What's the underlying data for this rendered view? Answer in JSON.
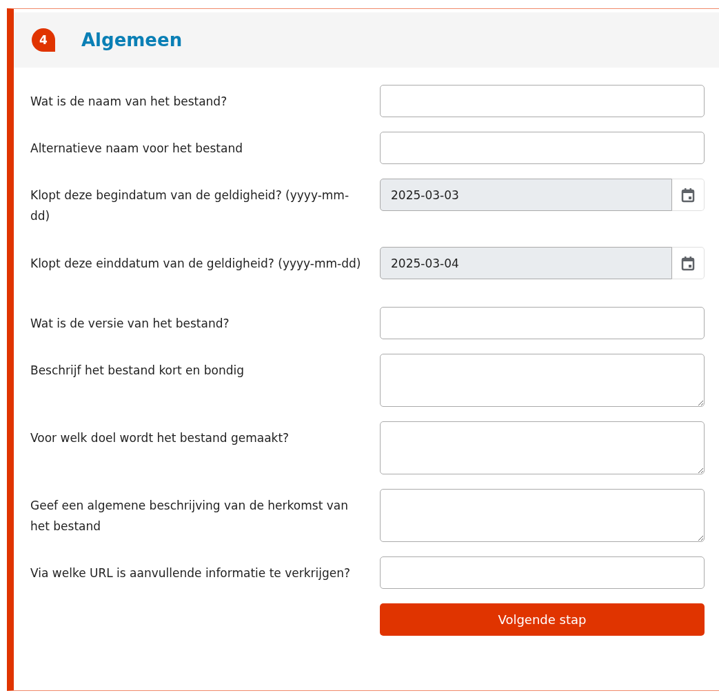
{
  "section": {
    "number": "4",
    "title": "Algemeen"
  },
  "fields": [
    {
      "kind": "text",
      "label": "Wat is de naam van het bestand?"
    },
    {
      "kind": "text",
      "label": "Alternatieve naam voor het bestand"
    },
    {
      "kind": "date",
      "label": "Klopt deze begindatum van de geldigheid? (yyyy-mm-dd)",
      "value": "2025-03-03"
    },
    {
      "kind": "date",
      "label": "Klopt deze einddatum van de geldigheid? (yyyy-mm-dd)",
      "value": "2025-03-04"
    },
    {
      "kind": "text",
      "label": "Wat is de versie van het bestand?"
    },
    {
      "kind": "textarea",
      "label": "Beschrijf het bestand kort en bondig"
    },
    {
      "kind": "textarea",
      "label": "Voor welk doel wordt het bestand gemaakt?"
    },
    {
      "kind": "textarea",
      "label": "Geef een algemene beschrijving van de herkomst van het bestand"
    },
    {
      "kind": "text",
      "label": "Via welke URL is aanvullende informatie te verkrijgen?"
    }
  ],
  "submit": "Volgende stap"
}
